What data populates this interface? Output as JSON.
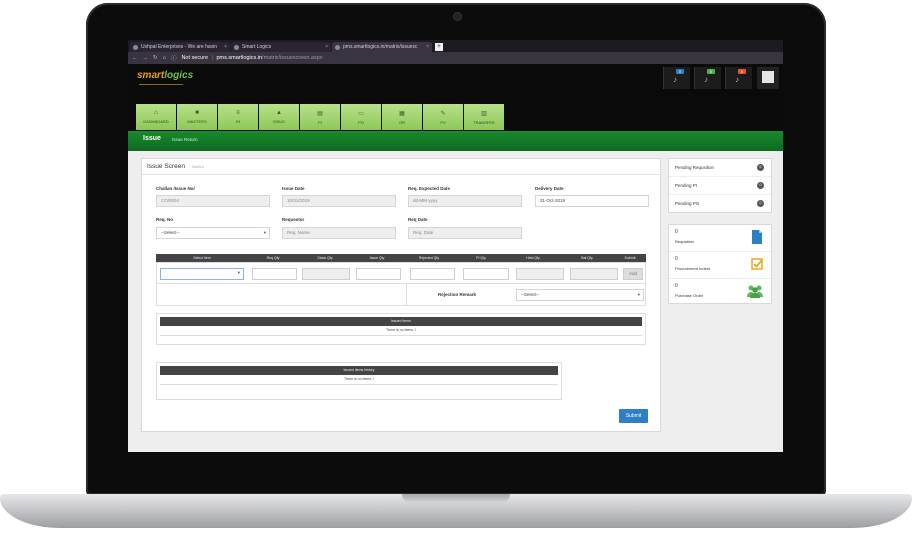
{
  "browser": {
    "tabs": [
      {
        "label": "Ushpal Enterprises - We are havin"
      },
      {
        "label": "Smart Logics"
      },
      {
        "label": "pms.smartlogics.in/matrix/issuesc"
      }
    ],
    "security": "Not secure",
    "url_domain": "pms.smartlogics.in",
    "url_path": "/matrix/issuescreen.aspx"
  },
  "app": {
    "logo_a": "smart",
    "logo_b": "logics",
    "notifications": [
      {
        "count": "0",
        "color": "#2f7fc4"
      },
      {
        "count": "0",
        "color": "#4caf50"
      },
      {
        "count": "0",
        "color": "#e0562a"
      }
    ]
  },
  "nav": {
    "items": [
      {
        "label": "DASHBOARD",
        "icon": "home-icon"
      },
      {
        "label": "MASTERS",
        "icon": "briefcase-icon"
      },
      {
        "label": "RI",
        "icon": "list-icon"
      },
      {
        "label": "ISSUE",
        "icon": "user-icon"
      },
      {
        "label": "PI",
        "icon": "doc-icon"
      },
      {
        "label": "PO",
        "icon": "cart-icon"
      },
      {
        "label": "GR",
        "icon": "calendar-icon"
      },
      {
        "label": "PV",
        "icon": "receipt-icon"
      },
      {
        "label": "TRANSFER",
        "icon": "transfer-icon"
      }
    ]
  },
  "section": {
    "title": "Issue",
    "sub": "Issue Return"
  },
  "screen": {
    "title": "Issue Screen",
    "subtitle": "Matrix ▸",
    "challan_label": "Challan /Issue No/",
    "challan_value": "CO/0004",
    "issue_date_label": "Issue Date",
    "issue_date_value": "10/31/2019",
    "req_expected_label": "Req. Expected Date",
    "req_expected_placeholder": "dd-MM-yyyy",
    "delivery_label": "Delivery Date",
    "delivery_value": "31-Oct-2019",
    "req_no_label": "Req. No",
    "req_no_value": "--Select--",
    "requestor_label": "Requestor",
    "requestor_placeholder": "Req. Name",
    "req_date_label": "Req Date",
    "req_date_placeholder": "Req. Date"
  },
  "grid": {
    "columns": [
      "Select Item",
      "Req Qty",
      "Stock Qty",
      "Issue Qty",
      "Rejected Qty",
      "PI Qty",
      "Held Qty",
      "Bal Qty",
      "Submit"
    ],
    "add_label": "Add",
    "rejection_label": "Rejection Remark",
    "rejection_value": "--Select--"
  },
  "issued_items": {
    "title": "Issued Items",
    "empty": "There is no Items..!"
  },
  "issued_history": {
    "title": "Issued Items history",
    "empty": "There is no Items..!"
  },
  "submit_label": "Submit",
  "pending": [
    {
      "label": "Pending Requsition",
      "count": "0"
    },
    {
      "label": "Pending PI",
      "count": "0"
    },
    {
      "label": "Pending PO",
      "count": "0"
    }
  ],
  "stats": [
    {
      "value": "0",
      "label": "Requsition",
      "icon": "document-icon",
      "color": "#2f7fc4"
    },
    {
      "value": "0",
      "label": "Procurement Indent",
      "icon": "checkbox-icon",
      "color": "#e8a820"
    },
    {
      "value": "0",
      "label": "Purchase Order",
      "icon": "group-icon",
      "color": "#5cb85c"
    }
  ]
}
